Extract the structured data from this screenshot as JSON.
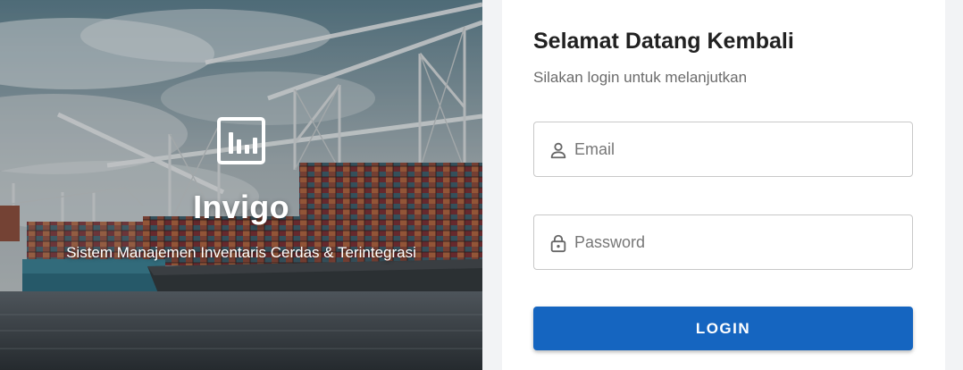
{
  "hero": {
    "brand_name": "Invigo",
    "tagline": "Sistem Manajemen Inventaris Cerdas & Terintegrasi",
    "logo_icon": "bar-chart-icon"
  },
  "login": {
    "title": "Selamat Datang Kembali",
    "subtitle": "Silakan login untuk melanjutkan",
    "email": {
      "placeholder": "Email",
      "value": "",
      "icon": "user-icon"
    },
    "password": {
      "placeholder": "Password",
      "value": "",
      "icon": "lock-icon"
    },
    "button_label": "LOGIN"
  },
  "colors": {
    "primary": "#1565c0",
    "page_background": "#f2f3f5",
    "panel_background": "#ffffff"
  }
}
